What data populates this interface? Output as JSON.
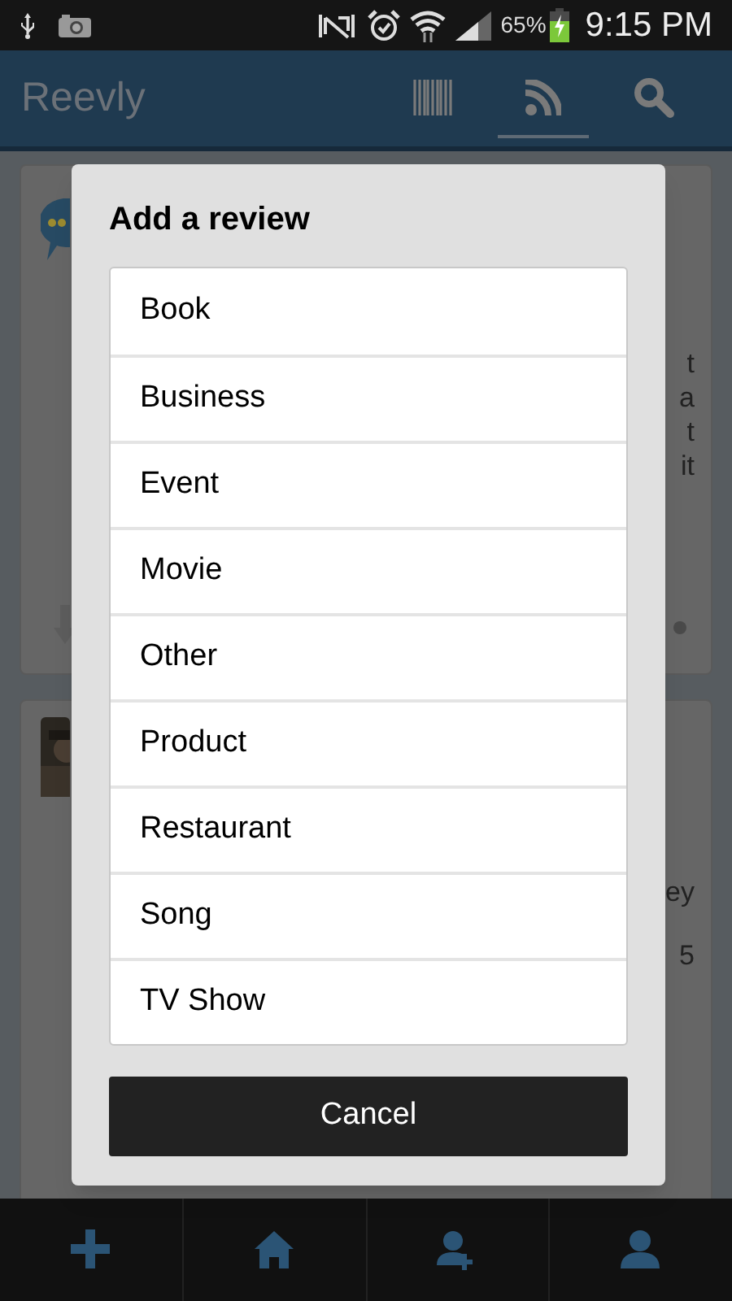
{
  "status_bar": {
    "battery": "65%",
    "time": "9:15 PM"
  },
  "app_bar": {
    "title": "Reevly",
    "actions": [
      {
        "kind": "barcode",
        "selected": false
      },
      {
        "kind": "feed",
        "selected": true
      },
      {
        "kind": "search",
        "selected": false
      }
    ]
  },
  "feed": [
    {
      "kind": "review-bubble",
      "fragments": [
        "t",
        "a",
        "t",
        "it"
      ]
    },
    {
      "fragments": [
        "ey",
        "5"
      ]
    }
  ],
  "dialog": {
    "title": "Add a review",
    "options": [
      "Book",
      "Business",
      "Event",
      "Movie",
      "Other",
      "Product",
      "Restaurant",
      "Song",
      "TV Show"
    ],
    "cancel": "Cancel"
  },
  "bottom_nav": [
    {
      "kind": "add"
    },
    {
      "kind": "home"
    },
    {
      "kind": "add-user"
    },
    {
      "kind": "user"
    }
  ]
}
